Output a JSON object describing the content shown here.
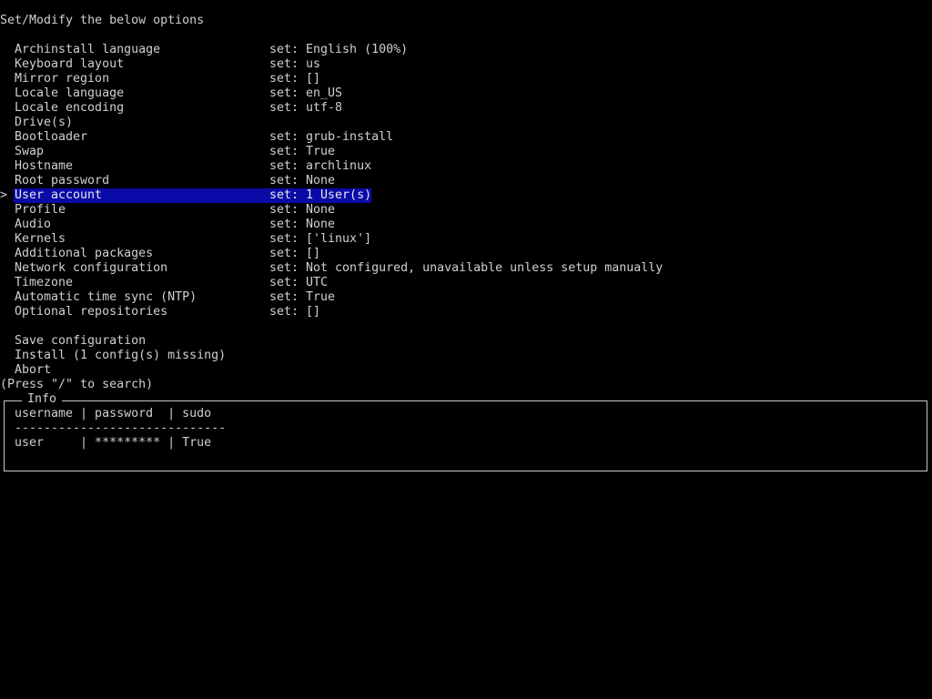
{
  "header": {
    "title": "Set/Modify the below options"
  },
  "menu": {
    "cursor": ">",
    "items": [
      {
        "label": "Archinstall language",
        "value": "set: English (100%)"
      },
      {
        "label": "Keyboard layout",
        "value": "set: us"
      },
      {
        "label": "Mirror region",
        "value": "set: []"
      },
      {
        "label": "Locale language",
        "value": "set: en_US"
      },
      {
        "label": "Locale encoding",
        "value": "set: utf-8"
      },
      {
        "label": "Drive(s)",
        "value": ""
      },
      {
        "label": "Bootloader",
        "value": "set: grub-install"
      },
      {
        "label": "Swap",
        "value": "set: True"
      },
      {
        "label": "Hostname",
        "value": "set: archlinux"
      },
      {
        "label": "Root password",
        "value": "set: None"
      },
      {
        "label": "User account",
        "value": "set: 1 User(s)"
      },
      {
        "label": "Profile",
        "value": "set: None"
      },
      {
        "label": "Audio",
        "value": "set: None"
      },
      {
        "label": "Kernels",
        "value": "set: ['linux']"
      },
      {
        "label": "Additional packages",
        "value": "set: []"
      },
      {
        "label": "Network configuration",
        "value": "set: Not configured, unavailable unless setup manually"
      },
      {
        "label": "Timezone",
        "value": "set: UTC"
      },
      {
        "label": "Automatic time sync (NTP)",
        "value": "set: True"
      },
      {
        "label": "Optional repositories",
        "value": "set: []"
      }
    ],
    "actions": [
      {
        "label": "Save configuration"
      },
      {
        "label": "Install (1 config(s) missing)"
      },
      {
        "label": "Abort"
      }
    ]
  },
  "hint": "(Press \"/\" to search)",
  "info": {
    "title": "Info",
    "header_row": "username | password  | sudo",
    "separator": "-----------------------------",
    "data_row": "user     | ********* | True"
  },
  "colors": {
    "background": "#000000",
    "text": "#d0d0d0",
    "selection": "#0a0aa8"
  }
}
